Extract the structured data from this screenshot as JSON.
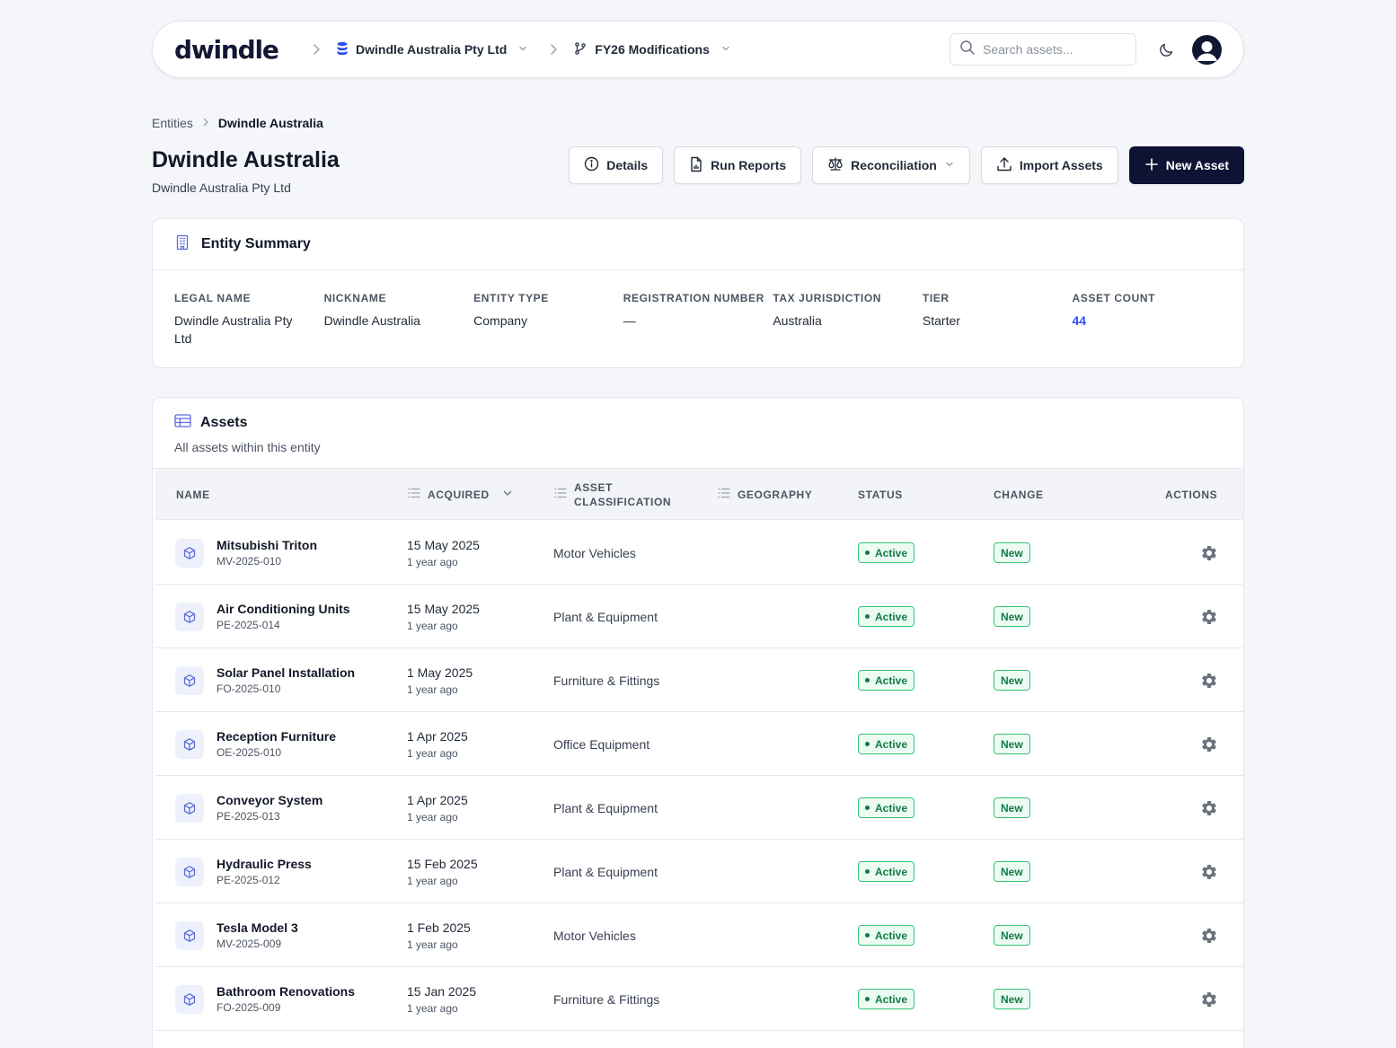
{
  "topbar": {
    "logo": "dwindle",
    "entity_switcher": "Dwindle Australia Pty Ltd",
    "branch_switcher": "FY26 Modifications",
    "search_placeholder": "Search assets..."
  },
  "breadcrumb": {
    "root": "Entities",
    "current": "Dwindle Australia"
  },
  "page": {
    "title": "Dwindle Australia",
    "subtitle": "Dwindle Australia Pty Ltd"
  },
  "actions": {
    "details": "Details",
    "run_reports": "Run Reports",
    "reconciliation": "Reconciliation",
    "import_assets": "Import Assets",
    "new_asset": "New Asset"
  },
  "summary": {
    "title": "Entity Summary",
    "fields": [
      {
        "label": "LEGAL NAME",
        "value": "Dwindle Australia Pty Ltd"
      },
      {
        "label": "NICKNAME",
        "value": "Dwindle Australia"
      },
      {
        "label": "ENTITY TYPE",
        "value": "Company"
      },
      {
        "label": "REGISTRATION NUMBER",
        "value": "—"
      },
      {
        "label": "TAX JURISDICTION",
        "value": "Australia"
      },
      {
        "label": "TIER",
        "value": "Starter"
      },
      {
        "label": "ASSET COUNT",
        "value": "44"
      }
    ]
  },
  "assets": {
    "title": "Assets",
    "description": "All assets within this entity",
    "columns": {
      "name": "NAME",
      "acquired": "ACQUIRED",
      "classification_1": "ASSET",
      "classification_2": "CLASSIFICATION",
      "geography": "GEOGRAPHY",
      "status": "STATUS",
      "change": "CHANGE",
      "actions": "ACTIONS"
    },
    "rows": [
      {
        "name": "Mitsubishi Triton",
        "code": "MV-2025-010",
        "date": "15 May 2025",
        "relative": "1 year ago",
        "classification": "Motor Vehicles",
        "status": "Active",
        "change": "New"
      },
      {
        "name": "Air Conditioning Units",
        "code": "PE-2025-014",
        "date": "15 May 2025",
        "relative": "1 year ago",
        "classification": "Plant & Equipment",
        "status": "Active",
        "change": "New"
      },
      {
        "name": "Solar Panel Installation",
        "code": "FO-2025-010",
        "date": "1 May 2025",
        "relative": "1 year ago",
        "classification": "Furniture & Fittings",
        "status": "Active",
        "change": "New"
      },
      {
        "name": "Reception Furniture",
        "code": "OE-2025-010",
        "date": "1 Apr 2025",
        "relative": "1 year ago",
        "classification": "Office Equipment",
        "status": "Active",
        "change": "New"
      },
      {
        "name": "Conveyor System",
        "code": "PE-2025-013",
        "date": "1 Apr 2025",
        "relative": "1 year ago",
        "classification": "Plant & Equipment",
        "status": "Active",
        "change": "New"
      },
      {
        "name": "Hydraulic Press",
        "code": "PE-2025-012",
        "date": "15 Feb 2025",
        "relative": "1 year ago",
        "classification": "Plant & Equipment",
        "status": "Active",
        "change": "New"
      },
      {
        "name": "Tesla Model 3",
        "code": "MV-2025-009",
        "date": "1 Feb 2025",
        "relative": "1 year ago",
        "classification": "Motor Vehicles",
        "status": "Active",
        "change": "New"
      },
      {
        "name": "Bathroom Renovations",
        "code": "FO-2025-009",
        "date": "15 Jan 2025",
        "relative": "1 year ago",
        "classification": "Furniture & Fittings",
        "status": "Active",
        "change": "New"
      }
    ]
  },
  "colors": {
    "primary": "#0e1233",
    "link": "#2f4ef2",
    "success_text": "#137a46",
    "success_border": "#34c47a",
    "success_bg": "#ecfbf3",
    "page_bg": "#f4f6fa",
    "icon_accent": "#5b6ad8"
  },
  "icons": {
    "entity": "database-icon",
    "branch": "git-branch-icon",
    "search": "search-icon",
    "theme": "moon-icon",
    "user": "user-avatar-icon",
    "summary": "building-icon",
    "assets": "table-icon",
    "row": "cube-icon",
    "row_action": "gear-icon"
  }
}
